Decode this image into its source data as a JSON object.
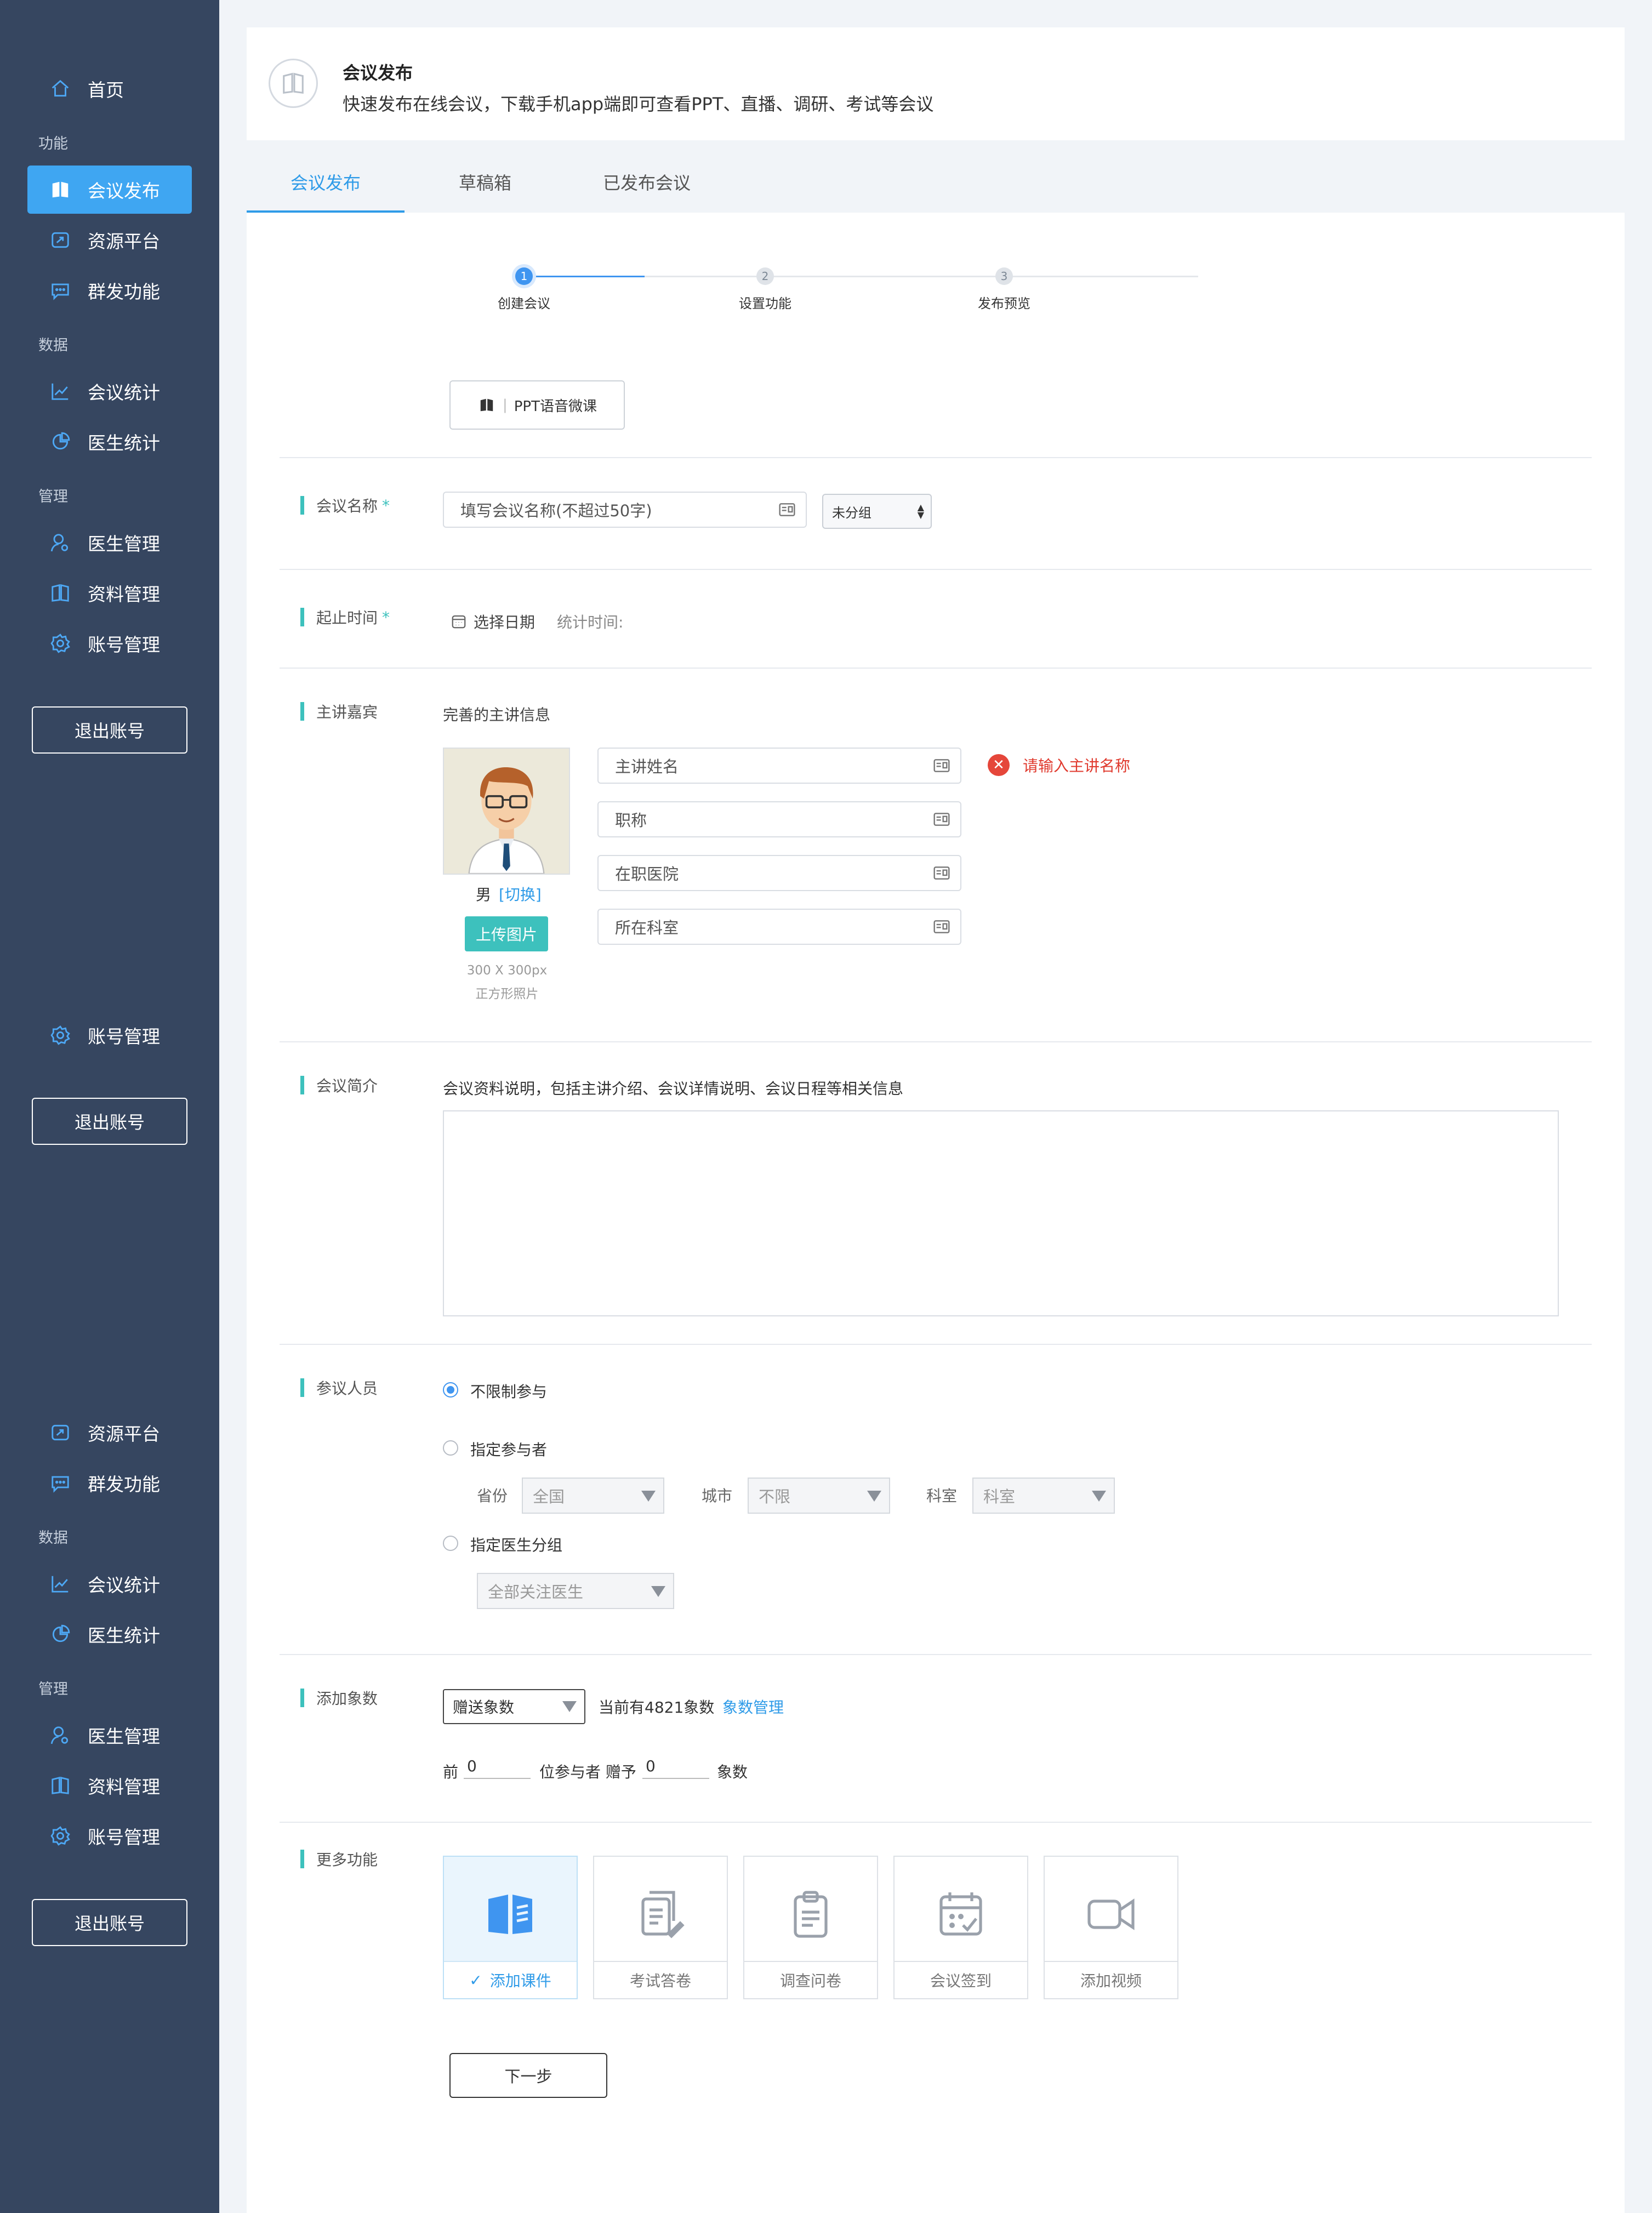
{
  "sidebar": {
    "home": "首页",
    "groups": {
      "function": "功能",
      "data": "数据",
      "manage": "管理"
    },
    "items": {
      "meeting_publish": "会议发布",
      "resource_platform": "资源平台",
      "group_send": "群发功能",
      "meeting_stats": "会议统计",
      "doctor_stats": "医生统计",
      "doctor_manage": "医生管理",
      "material_manage": "资料管理",
      "account_manage": "账号管理"
    },
    "logout": "退出账号"
  },
  "header": {
    "title": "会议发布",
    "description": "快速发布在线会议，下载手机app端即可查看PPT、直播、调研、考试等会议"
  },
  "tabs": [
    "会议发布",
    "草稿箱",
    "已发布会议"
  ],
  "steps": [
    {
      "num": "1",
      "label": "创建会议"
    },
    {
      "num": "2",
      "label": "设置功能"
    },
    {
      "num": "3",
      "label": "发布预览"
    }
  ],
  "ppt_button": "PPT语音微课",
  "meeting_name": {
    "label": "会议名称",
    "required": "*",
    "placeholder": "填写会议名称(不超过50字)",
    "group_select": "未分组"
  },
  "time": {
    "label": "起止时间",
    "required": "*",
    "choose_date": "选择日期",
    "stat_time": "统计时间:"
  },
  "speaker": {
    "label": "主讲嘉宾",
    "hint": "完善的主讲信息",
    "gender": "男",
    "switch": "[切换]",
    "upload": "上传图片",
    "size_hint": "300 X 300px",
    "shape_hint": "正方形照片",
    "fields": [
      "主讲姓名",
      "职称",
      "在职医院",
      "所在科室"
    ],
    "error": "请输入主讲名称"
  },
  "intro": {
    "label": "会议简介",
    "hint": "会议资料说明，包括主讲介绍、会议详情说明、会议日程等相关信息"
  },
  "participants": {
    "label": "参议人员",
    "unlimited": "不限制参与",
    "specified": "指定参与者",
    "province_label": "省份",
    "province_value": "全国",
    "city_label": "城市",
    "city_value": "不限",
    "dept_label": "科室",
    "dept_value": "科室",
    "doctor_group": "指定医生分组",
    "doctor_group_value": "全部关注医生"
  },
  "points": {
    "label": "添加象数",
    "select": "赠送象数",
    "current": "当前有4821象数",
    "manage": "象数管理",
    "prefix": "前",
    "first_value": "0",
    "middle": "位参与者 赠予",
    "second_value": "0",
    "suffix": "象数"
  },
  "more": {
    "label": "更多功能",
    "features": [
      "添加课件",
      "考试答卷",
      "调查问卷",
      "会议签到",
      "添加视频"
    ]
  },
  "next_button": "下一步"
}
